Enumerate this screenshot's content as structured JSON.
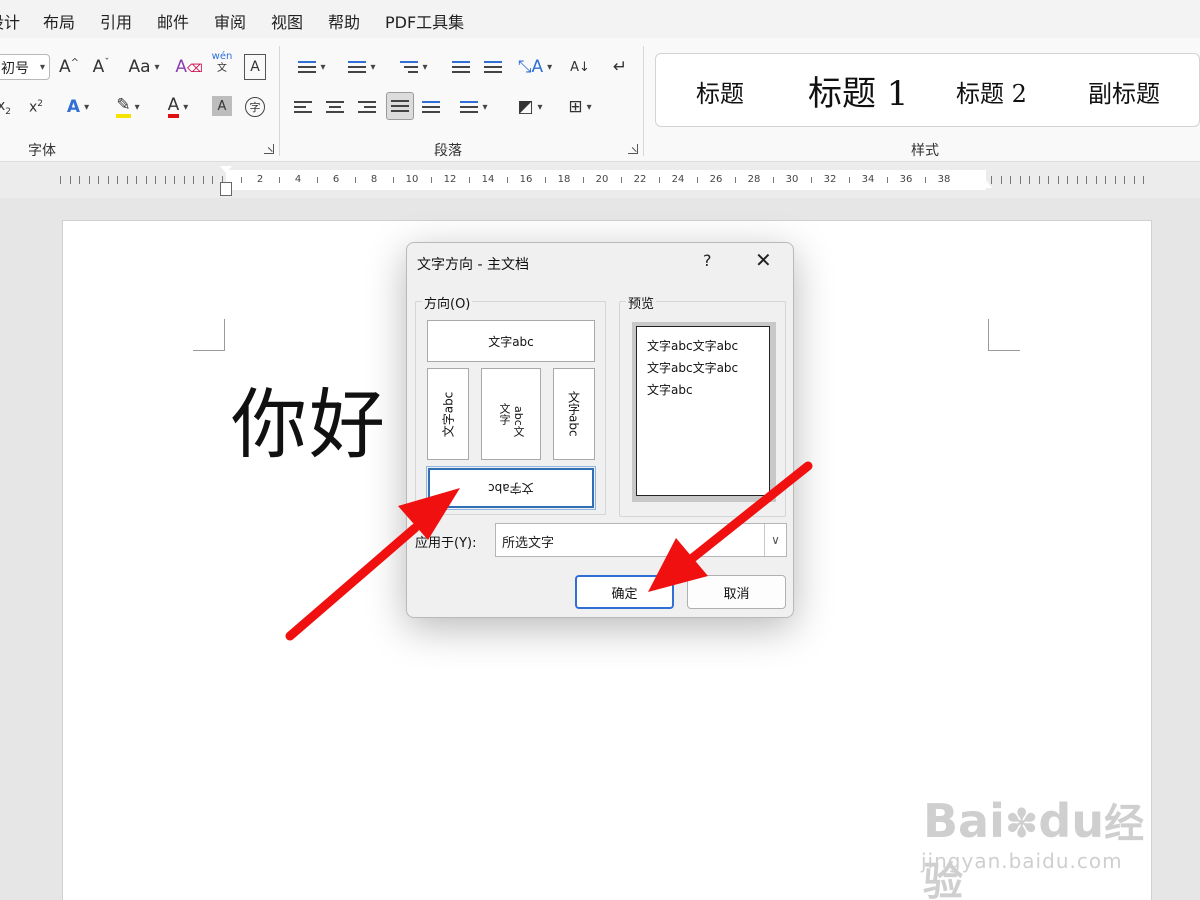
{
  "menu": [
    "设计",
    "布局",
    "引用",
    "邮件",
    "审阅",
    "视图",
    "帮助",
    "PDF工具集"
  ],
  "ribbon": {
    "font_size_value": "初号",
    "groups": {
      "font": "字体",
      "paragraph": "段落",
      "styles": "样式"
    },
    "font_buttons": {
      "grow": "A^",
      "shrink": "Aˇ",
      "case": "Aa",
      "clear": "A",
      "phonetic_top": "wén",
      "phonetic_bottom": "文",
      "border": "A",
      "subscript": "x₂",
      "superscript": "x²",
      "effects": "A",
      "highlight": "✎",
      "color": "A",
      "shade": "A",
      "enclose": "字"
    },
    "styles": [
      "标题",
      "标题 1",
      "标题 2",
      "副标题"
    ]
  },
  "ruler_numbers": [
    "2",
    "4",
    "6",
    "8",
    "10",
    "12",
    "14",
    "16",
    "18",
    "20",
    "22",
    "24",
    "26",
    "28",
    "30",
    "32",
    "34",
    "36",
    "38"
  ],
  "document": {
    "text": "你好"
  },
  "dialog": {
    "title": "文字方向 - 主文档",
    "help": "?",
    "close": "✕",
    "direction_label": "方向(O)",
    "direction_hotkey": "O",
    "preview_label": "预览",
    "options": {
      "horizontal": "文字abc",
      "vertical_rot_left": "文字abc",
      "vertical_stack_top": "文字",
      "vertical_stack_bottom": "abc文",
      "vertical_rot_right": "文字abc",
      "horizontal_flipped": "文字abc"
    },
    "preview_lines": [
      "文字abc文字abc",
      "文字abc文字abc",
      "文字abc"
    ],
    "apply_to_label": "应用于(Y):",
    "apply_to_value": "所选文字",
    "ok": "确定",
    "cancel": "取消"
  },
  "watermark": {
    "logo": "Bai",
    "logo2": "du",
    "brand": "经验",
    "url": "jingyan.baidu.com"
  }
}
